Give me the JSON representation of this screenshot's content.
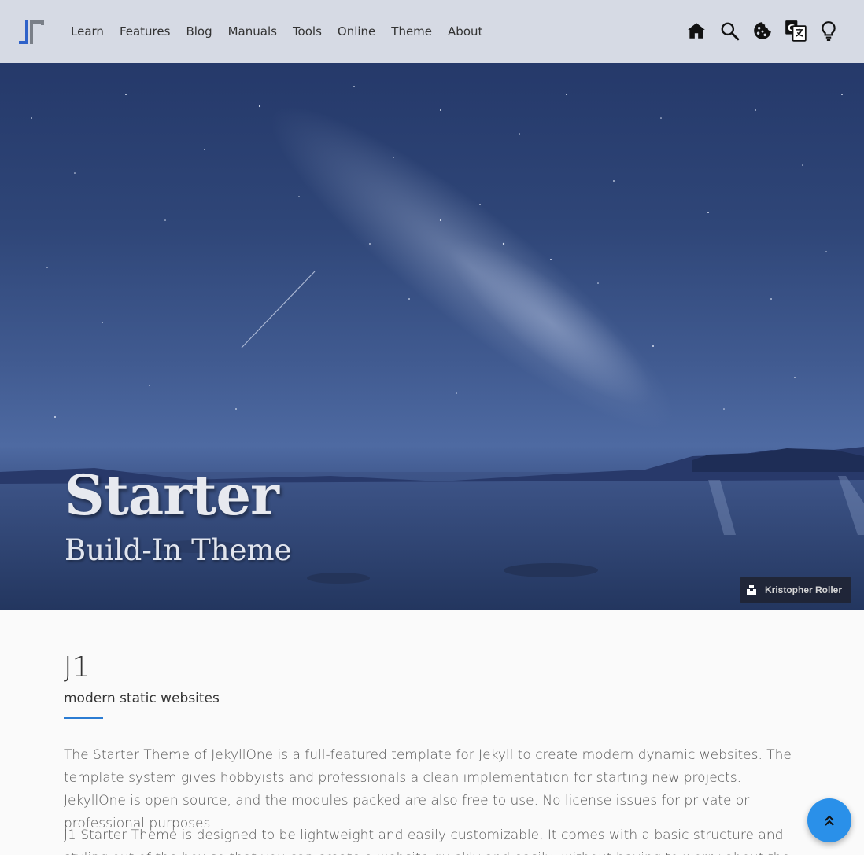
{
  "nav": {
    "logo_icon": "j1-logo-icon",
    "links": [
      "Learn",
      "Features",
      "Blog",
      "Manuals",
      "Tools",
      "Online",
      "Theme",
      "About"
    ],
    "icons": [
      "home-icon",
      "search-icon",
      "cookie-icon",
      "translate-icon",
      "lightbulb-icon"
    ]
  },
  "hero": {
    "title": "Starter",
    "subtitle": "Build-In Theme",
    "credit": "Kristopher Roller",
    "credit_icon": "unsplash-icon"
  },
  "content": {
    "heading": "J1",
    "subheading": "modern static websites",
    "paragraph1": "The Starter Theme of JekyllOne is a full-featured template for Jekyll to create modern dynamic websites. The template system gives hobbyists and professionals a clean implementation for starting new projects. JekyllOne is open source, and the modules packed are also free to use. No license issues for private or professional purposes.",
    "paragraph2": "J1 Starter Theme is designed to be lightweight and easily customizable. It comes with a basic structure and styling out of the box so that you can create a website quickly and easily, without having to worry about the code."
  },
  "fab": {
    "icon": "double-chevron-up-icon"
  },
  "colors": {
    "navbar_bg": "#d6dae4",
    "hero_tint": "#2f4678",
    "accent": "#2b7cd3",
    "fab": "#2a90e9"
  }
}
